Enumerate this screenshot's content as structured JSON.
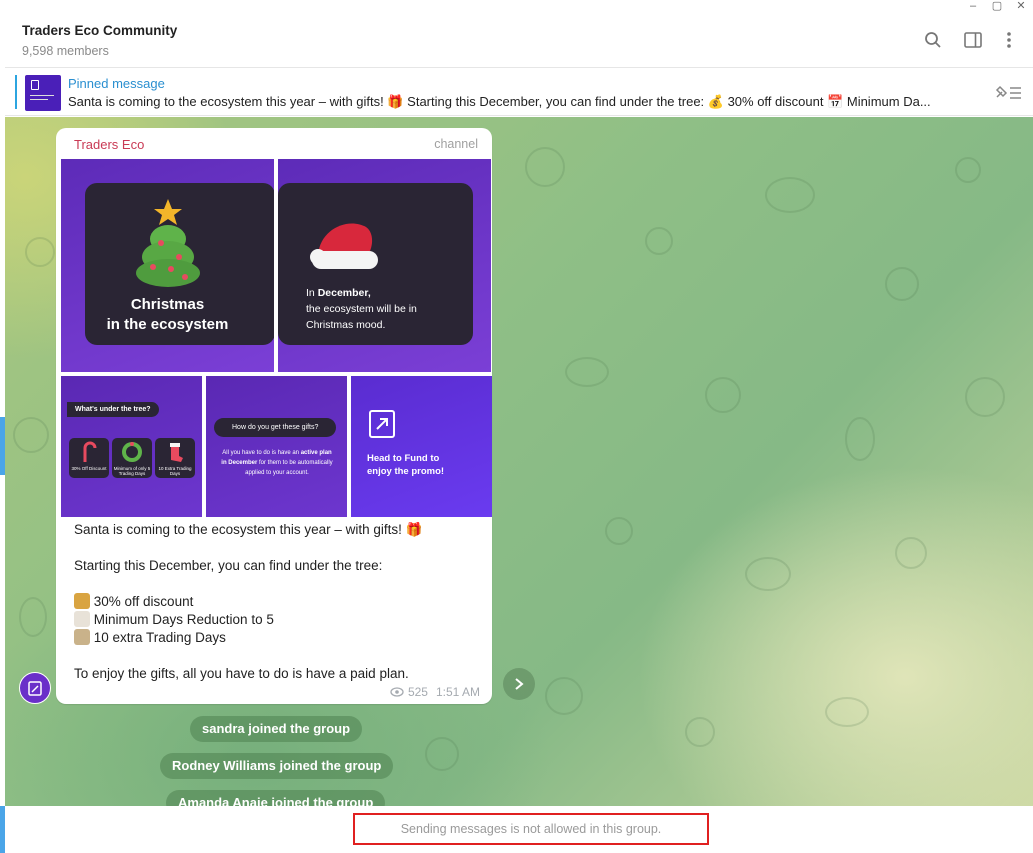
{
  "header": {
    "title": "Traders Eco Community",
    "members": "9,598 members",
    "icons": [
      "search-icon",
      "sidebar-toggle-icon",
      "more-vertical-icon"
    ]
  },
  "pinned": {
    "label": "Pinned message",
    "text": "Santa is coming to the ecosystem this year – with gifts! 🎁 Starting this December, you can find under the tree: 💰 30% off discount 📅 Minimum Da..."
  },
  "message": {
    "sender": "Traders Eco",
    "signature": "channel",
    "tile1_title_line1": "Christmas",
    "tile1_title_line2": "in the ecosystem",
    "tile2_in": "In",
    "tile2_month": "December,",
    "tile2_line2": "the ecosystem will be in",
    "tile2_line3": "Christmas mood.",
    "tile3_label": "What's under the tree?",
    "tile3_gift1": "30% Off Discount",
    "tile3_gift2": "Minimum of only 5 Trading Days",
    "tile3_gift3": "10 Extra Trading Days",
    "tile4_pill": "How do you get these gifts?",
    "tile4_text1": "All you have to do is have an",
    "tile4_text_bold": "active plan in December",
    "tile4_text2": "for them to be automatically applied to your account.",
    "tile5_line1": "Head to Fund to",
    "tile5_line2": "enjoy the promo!",
    "body_line1": "Santa is coming to the ecosystem this year – with gifts! 🎁",
    "body_line2": "Starting this December, you can find under the tree:",
    "body_line3": "30% off discount",
    "body_line4": "Minimum Days Reduction to 5",
    "body_line5": "10 extra Trading Days",
    "body_line6": "To enjoy the gifts, all you have to do is have a paid plan.",
    "views": "525",
    "time": "1:51 AM"
  },
  "service_messages": [
    "sandra joined the group",
    "Rodney Williams joined the group",
    "Amanda Anaie joined the group"
  ],
  "footer": {
    "notice": "Sending messages is not allowed in this group."
  }
}
